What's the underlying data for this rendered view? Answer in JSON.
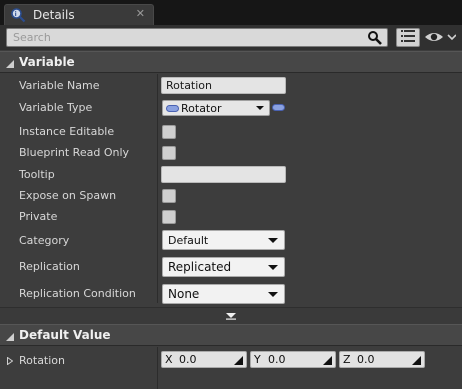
{
  "tab": {
    "label": "Details",
    "close": "✕",
    "icon": "details-magnifier-icon"
  },
  "search": {
    "placeholder": "Search",
    "value": ""
  },
  "toolbar": {
    "view_options_icon": "list-view-icon",
    "visibility_icon": "eye-icon"
  },
  "variable_category": {
    "title": "Variable",
    "properties": [
      {
        "label": "Variable Name",
        "value": "Rotation"
      },
      {
        "label": "Variable Type",
        "value": "Rotator"
      },
      {
        "label": "Instance Editable",
        "checked": false
      },
      {
        "label": "Blueprint Read Only",
        "checked": false
      },
      {
        "label": "Tooltip",
        "value": ""
      },
      {
        "label": "Expose on Spawn",
        "checked": false
      },
      {
        "label": "Private",
        "checked": false
      },
      {
        "label": "Category",
        "value": "Default"
      },
      {
        "label": "Replication",
        "value": "Replicated"
      },
      {
        "label": "Replication Condition",
        "value": "None"
      }
    ]
  },
  "default_value_category": {
    "title": "Default Value",
    "property": {
      "label": "Rotation",
      "x_axis": "X",
      "x": "0.0",
      "y_axis": "Y",
      "y": "0.0",
      "z_axis": "Z",
      "z": "0.0"
    }
  },
  "colors": {
    "pin_struct": "#8aa1e0",
    "panel": "#3d3d3d",
    "header": "#474747"
  }
}
